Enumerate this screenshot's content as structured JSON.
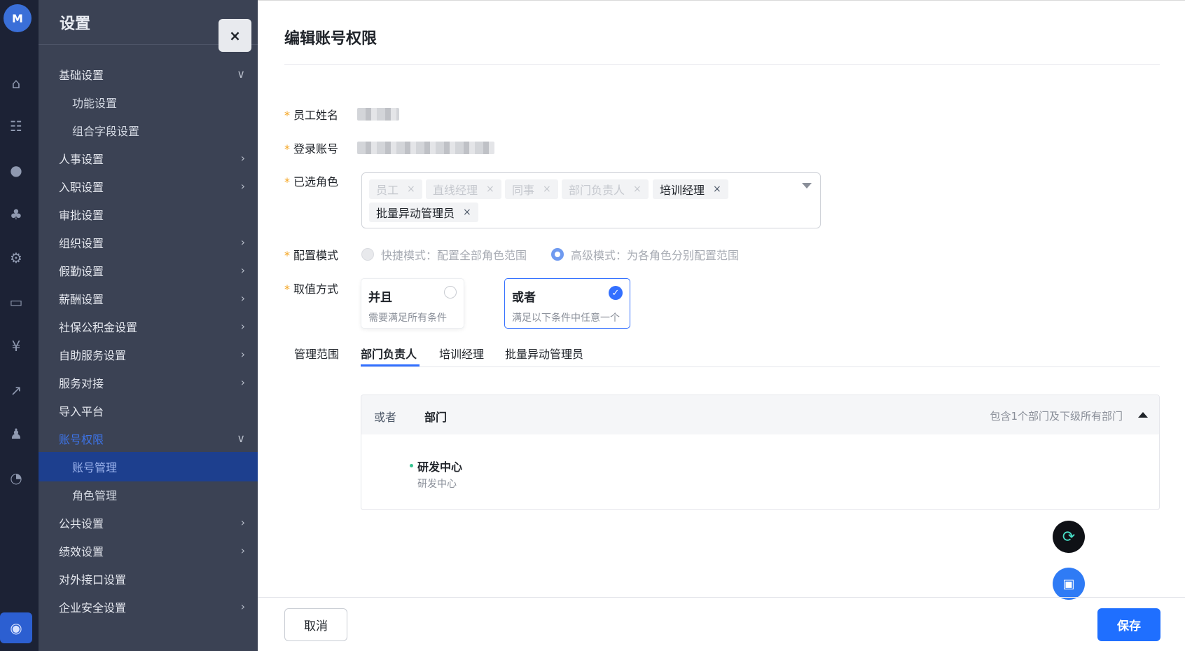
{
  "rail": {
    "logo": "M",
    "icons": [
      "⌂",
      "☷",
      "●",
      "♣",
      "⚙",
      "▭",
      "¥",
      "↗",
      "♟",
      "◔",
      "◉"
    ]
  },
  "menu": {
    "title": "设置",
    "items": [
      {
        "label": "基础设置",
        "chev": "∨"
      },
      {
        "label": "功能设置"
      },
      {
        "label": "组合字段设置"
      },
      {
        "label": "人事设置",
        "chev": "›"
      },
      {
        "label": "入职设置",
        "chev": "›"
      },
      {
        "label": "审批设置"
      },
      {
        "label": "组织设置",
        "chev": "›"
      },
      {
        "label": "假勤设置",
        "chev": "›"
      },
      {
        "label": "薪酬设置",
        "chev": "›"
      },
      {
        "label": "社保公积金设置",
        "chev": "›"
      },
      {
        "label": "自助服务设置",
        "chev": "›"
      },
      {
        "label": "服务对接",
        "chev": "›"
      },
      {
        "label": "导入平台"
      },
      {
        "label": "账号权限",
        "chev": "∨"
      },
      {
        "label": "账号管理"
      },
      {
        "label": "角色管理"
      },
      {
        "label": "公共设置",
        "chev": "›"
      },
      {
        "label": "绩效设置",
        "chev": "›"
      },
      {
        "label": "对外接口设置"
      },
      {
        "label": "企业安全设置",
        "chev": "›"
      }
    ]
  },
  "close_label": "×",
  "drawer": {
    "title": "编辑账号权限",
    "required_mark": "*",
    "fields": {
      "employee_name_label": "员工姓名",
      "login_account_label": "登录账号",
      "roles_label": "已选角色",
      "config_mode_label": "配置模式",
      "value_mode_label": "取值方式"
    },
    "roles": [
      {
        "name": "员工",
        "state": "disabled"
      },
      {
        "name": "直线经理",
        "state": "disabled"
      },
      {
        "name": "同事",
        "state": "disabled"
      },
      {
        "name": "部门负责人",
        "state": "disabled"
      },
      {
        "name": "培训经理",
        "state": "normal"
      },
      {
        "name": "批量异动管理员",
        "state": "normal"
      }
    ],
    "tag_remove": "×",
    "config_modes": {
      "quick": "快捷模式：配置全部角色范围",
      "advanced": "高级模式：为各角色分别配置范围",
      "selected": "advanced"
    },
    "value_modes": {
      "and_title": "并且",
      "and_desc": "需要满足所有条件",
      "or_title": "或者",
      "or_desc": "满足以下条件中任意一个",
      "selected": "or",
      "check": "✓"
    },
    "scope": {
      "label": "管理范围",
      "tabs": [
        "部门负责人",
        "培训经理",
        "批量异动管理员"
      ],
      "active_tab": "部门负责人"
    },
    "condition": {
      "operator": "或者",
      "field": "部门",
      "summary": "包含1个部门及下级所有部门",
      "dept_name": "研发中心",
      "dept_path": "研发中心"
    },
    "cancel": "取消",
    "save": "保存"
  },
  "colors": {
    "primary": "#3370ff",
    "sidebar_selected": "#1d3f8e",
    "required": "#f5a623"
  }
}
